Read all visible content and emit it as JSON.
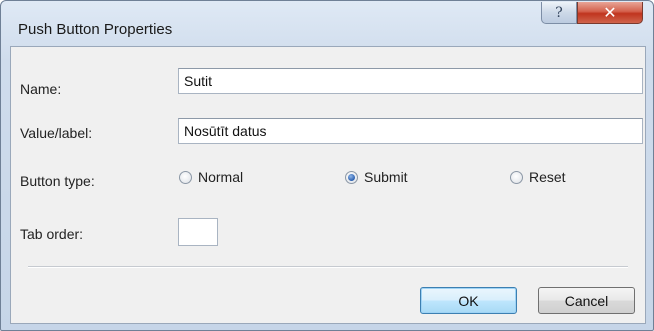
{
  "window": {
    "title": "Push Button Properties",
    "help_glyph": "?",
    "close_glyph": "✕"
  },
  "form": {
    "name": {
      "label": "Name:",
      "value": "Sutit"
    },
    "value_label": {
      "label": "Value/label:",
      "value": "Nosūtīt datus"
    },
    "button_type": {
      "label": "Button type:",
      "options": [
        {
          "label": "Normal",
          "checked": false
        },
        {
          "label": "Submit",
          "checked": true
        },
        {
          "label": "Reset",
          "checked": false
        }
      ]
    },
    "tab_order": {
      "label": "Tab order:",
      "value": ""
    }
  },
  "footer": {
    "ok_label": "OK",
    "cancel_label": "Cancel"
  }
}
